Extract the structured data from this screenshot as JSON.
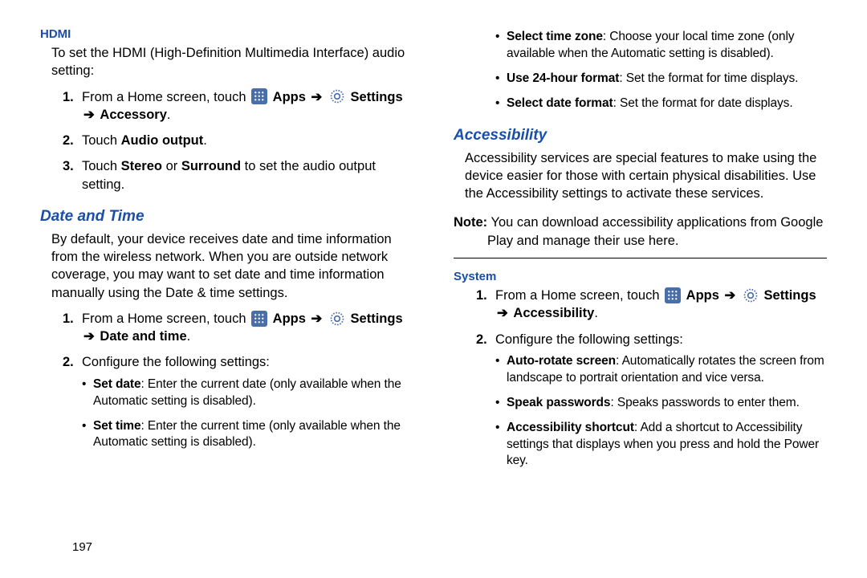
{
  "left": {
    "hdmi": {
      "heading": "HDMI",
      "intro": "To set the HDMI (High-Definition Multimedia Interface) audio setting:",
      "step1_pre": "From a Home screen, touch ",
      "apps": "Apps",
      "settings": "Settings",
      "accessory": "Accessory",
      "step2_pre": "Touch ",
      "step2_b": "Audio output",
      "step2_post": ".",
      "step3_pre": "Touch ",
      "step3_b1": "Stereo",
      "step3_mid": " or ",
      "step3_b2": "Surround",
      "step3_post": " to set the audio output setting."
    },
    "dt": {
      "heading": "Date and Time",
      "intro": "By default, your device receives date and time information from the wireless network. When you are outside network coverage, you may want to set date and time information manually using the Date & time settings.",
      "step1_pre": "From a Home screen, touch ",
      "apps": "Apps",
      "settings": "Settings",
      "datetime": "Date and time",
      "step2": "Configure the following settings:",
      "b_setdate_b": "Set date",
      "b_setdate_t": ": Enter the current date (only available when the Automatic setting is disabled).",
      "b_settime_b": "Set time",
      "b_settime_t": ": Enter the current time (only available when the Automatic setting is disabled)."
    }
  },
  "right": {
    "top_bullets": {
      "tz_b": "Select time zone",
      "tz_t": ": Choose your local time zone (only available when the Automatic setting is disabled).",
      "h24_b": "Use 24-hour format",
      "h24_t": ": Set the format for time displays.",
      "df_b": "Select date format",
      "df_t": ": Set the format for date displays."
    },
    "acc": {
      "heading": "Accessibility",
      "intro": "Accessibility services are special features to make using the device easier for those with certain physical disabilities. Use the Accessibility settings to activate these services.",
      "note_label": "Note:",
      "note_text": " You can download accessibility applications from Google Play and manage their use here.",
      "system_heading": "System",
      "step1_pre": "From a Home screen, touch ",
      "apps": "Apps",
      "settings": "Settings",
      "accessibility": "Accessibility",
      "step2": "Configure the following settings:",
      "b_auto_b": "Auto-rotate screen",
      "b_auto_t": ": Automatically rotates the screen from landscape to portrait orientation and vice versa.",
      "b_speak_b": "Speak passwords",
      "b_speak_t": ": Speaks passwords to enter them.",
      "b_short_b": "Accessibility shortcut",
      "b_short_t": ": Add a shortcut to Accessibility settings that displays when you press and hold the Power key."
    }
  },
  "page_number": "197",
  "arrow": "➔"
}
